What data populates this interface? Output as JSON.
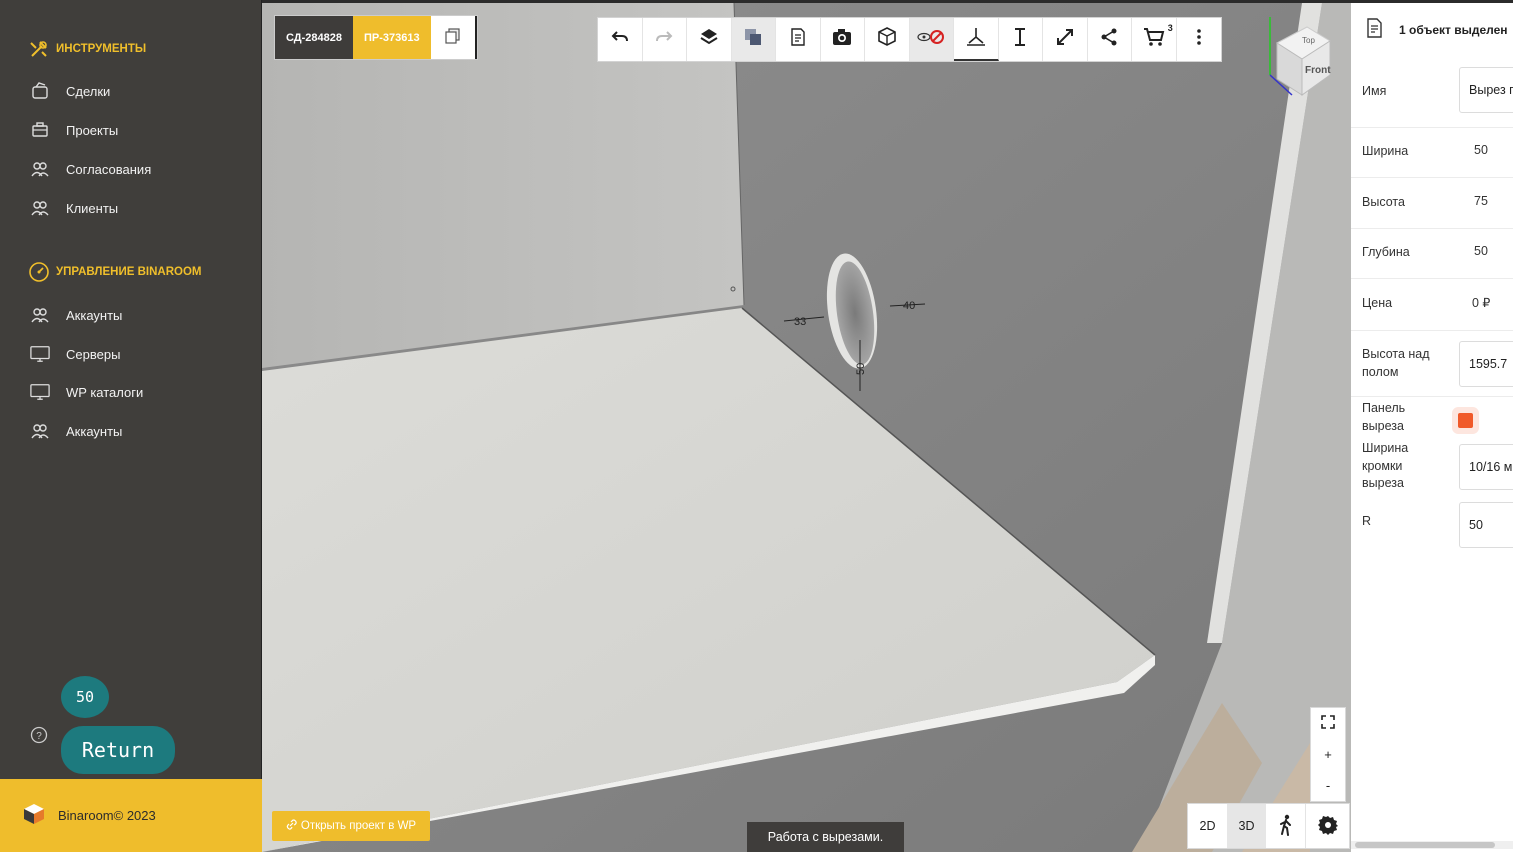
{
  "sidebar": {
    "section_tools": "ИНСТРУМЕНТЫ",
    "tools_items": [
      {
        "label": "Сделки",
        "icon": "deals-icon"
      },
      {
        "label": "Проекты",
        "icon": "projects-icon"
      },
      {
        "label": "Согласования",
        "icon": "approvals-icon"
      },
      {
        "label": "Клиенты",
        "icon": "clients-icon"
      }
    ],
    "section_manage": "УПРАВЛЕНИЕ BINAROOM",
    "manage_items": [
      {
        "label": "Аккаунты",
        "icon": "accounts-icon"
      },
      {
        "label": "Серверы",
        "icon": "servers-icon"
      },
      {
        "label": "WP каталоги",
        "icon": "wp-catalog-icon"
      },
      {
        "label": "Аккаунты",
        "icon": "accounts-icon"
      }
    ],
    "badge": "50",
    "return_label": "Return",
    "footer": "Binaroom© 2023",
    "accent": "#efbd2c",
    "bg": "#403e3b"
  },
  "viewport": {
    "tag_deal": "СД-284828",
    "tag_project": "ПР-373613",
    "cart_count": "3",
    "open_wp": "Открыть проект в WP",
    "status": "Работа с вырезами.",
    "dims": {
      "left": "33",
      "right": "40",
      "bottom": "50"
    },
    "cube_top": "Top",
    "cube_front": "Front",
    "zoom_in": "+",
    "zoom_out": "-",
    "view_2d": "2D",
    "view_3d": "3D"
  },
  "panel": {
    "title": "1 объект выделен",
    "fields": {
      "name_label": "Имя",
      "name_value": "Вырез п",
      "width_label": "Ширина",
      "width_value": "50",
      "height_label": "Высота",
      "height_value": "75",
      "depth_label": "Глубина",
      "depth_value": "50",
      "price_label": "Цена",
      "price_value": "0 ₽",
      "floor_label": "Высота над полом",
      "floor_value": "1595.7",
      "panel_label": "Панель выреза",
      "edge_label": "Ширина кромки выреза",
      "edge_value": "10/16 м",
      "r_label": "R",
      "r_value": "50"
    },
    "checkbox_color": "#f05a2a"
  }
}
